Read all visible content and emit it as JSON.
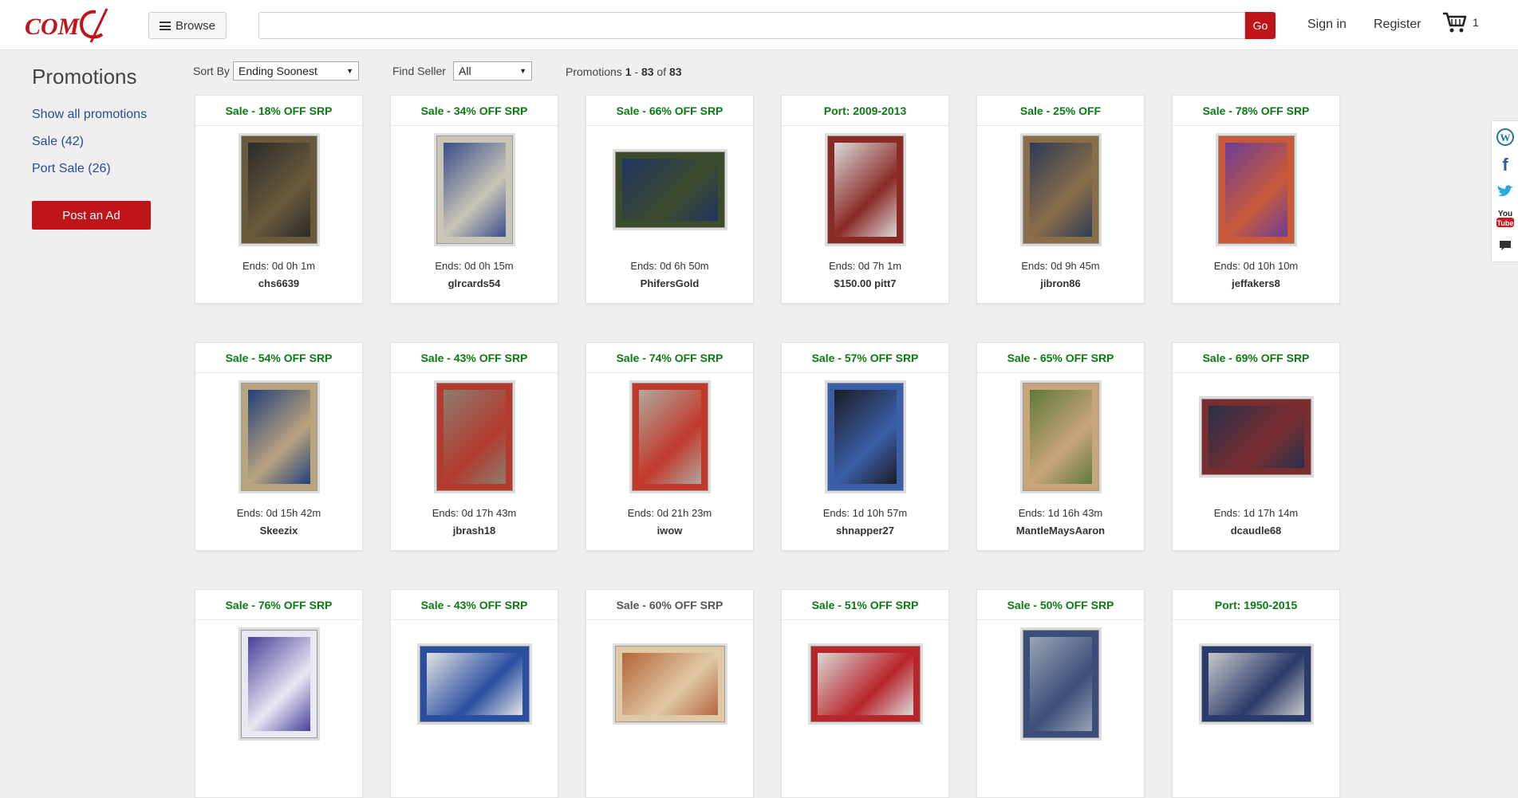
{
  "header": {
    "browse_label": "Browse",
    "search_placeholder": "",
    "go_label": "Go",
    "signin_label": "Sign in",
    "register_label": "Register",
    "cart_count": "1",
    "brand_color": "#c0141b"
  },
  "sidebar": {
    "title": "Promotions",
    "links": [
      {
        "label": "Show all promotions"
      },
      {
        "label": "Sale (42)"
      },
      {
        "label": "Port Sale (26)"
      }
    ],
    "post_ad_label": "Post an Ad"
  },
  "filters": {
    "sort_label": "Sort By",
    "sort_value": "Ending Soonest",
    "seller_label": "Find Seller",
    "seller_value": "All",
    "count_prefix": "Promotions",
    "count_start": "1",
    "count_end": "83",
    "count_of": "of",
    "count_total": "83"
  },
  "cards": [
    {
      "title": "Sale - 18% OFF SRP",
      "ends": "Ends: 0d 0h 1m",
      "seller": "chs6639",
      "img": "portrait",
      "c1": "#2b2b2b",
      "c2": "#6a5a3a"
    },
    {
      "title": "Sale - 34% OFF SRP",
      "ends": "Ends: 0d 0h 15m",
      "seller": "glrcards54",
      "img": "portrait",
      "c1": "#3b4d8a",
      "c2": "#c9c6b8"
    },
    {
      "title": "Sale - 66% OFF SRP",
      "ends": "Ends: 0d 6h 50m",
      "seller": "PhifersGold",
      "img": "landscape",
      "c1": "#1f3561",
      "c2": "#3c4b2c"
    },
    {
      "title": "Port: 2009-2013",
      "ends": "Ends: 0d 7h 1m",
      "seller": "$150.00 pitt7",
      "img": "portrait",
      "c1": "#d9d9d9",
      "c2": "#8a2a25"
    },
    {
      "title": "Sale - 25% OFF",
      "ends": "Ends: 0d 9h 45m",
      "seller": "jibron86",
      "img": "portrait",
      "c1": "#2d3b56",
      "c2": "#8a6e4a"
    },
    {
      "title": "Sale - 78% OFF SRP",
      "ends": "Ends: 0d 10h 10m",
      "seller": "jeffakers8",
      "img": "portrait",
      "c1": "#6c3d95",
      "c2": "#c85a3a"
    },
    {
      "title": "Sale - 54% OFF SRP",
      "ends": "Ends: 0d 15h 42m",
      "seller": "Skeezix",
      "img": "portrait",
      "c1": "#213f7a",
      "c2": "#b9a47e"
    },
    {
      "title": "Sale - 43% OFF SRP",
      "ends": "Ends: 0d 17h 43m",
      "seller": "jbrash18",
      "img": "portrait",
      "c1": "#8a7d6e",
      "c2": "#b23a2e"
    },
    {
      "title": "Sale - 74% OFF SRP",
      "ends": "Ends: 0d 21h 23m",
      "seller": "iwow",
      "img": "portrait",
      "c1": "#b0a9a0",
      "c2": "#c0392b"
    },
    {
      "title": "Sale - 57% OFF SRP",
      "ends": "Ends: 1d 10h 57m",
      "seller": "shnapper27",
      "img": "portrait",
      "c1": "#1c1c24",
      "c2": "#3b5fa8"
    },
    {
      "title": "Sale - 65% OFF SRP",
      "ends": "Ends: 1d 16h 43m",
      "seller": "MantleMaysAaron",
      "img": "portrait",
      "c1": "#5f7a3a",
      "c2": "#c9a57a"
    },
    {
      "title": "Sale - 69% OFF SRP",
      "ends": "Ends: 1d 17h 14m",
      "seller": "dcaudle68",
      "img": "landscape",
      "c1": "#26304a",
      "c2": "#7a2d30"
    },
    {
      "title": "Sale - 76% OFF SRP",
      "ends": "",
      "seller": "",
      "img": "portrait",
      "c1": "#4a3f9a",
      "c2": "#e8e8f2"
    },
    {
      "title": "Sale - 43% OFF SRP",
      "ends": "",
      "seller": "",
      "img": "landscape",
      "c1": "#e3e3e3",
      "c2": "#2a4fa0"
    },
    {
      "title": "Sale - 60% OFF SRP",
      "ends": "",
      "seller": "",
      "img": "landscape",
      "c1": "#b4653a",
      "c2": "#e0c9a6",
      "grey": true
    },
    {
      "title": "Sale - 51% OFF SRP",
      "ends": "",
      "seller": "",
      "img": "landscape",
      "c1": "#d8d8d8",
      "c2": "#b8252a"
    },
    {
      "title": "Sale - 50% OFF SRP",
      "ends": "",
      "seller": "",
      "img": "portrait",
      "c1": "#9aa4b4",
      "c2": "#3b4e7a"
    },
    {
      "title": "Port: 1950-2015",
      "ends": "",
      "seller": "",
      "img": "landscape",
      "c1": "#c9c9c9",
      "c2": "#2a3a6a"
    }
  ],
  "social": [
    "wordpress-icon",
    "facebook-icon",
    "twitter-icon",
    "youtube-icon",
    "comment-icon"
  ],
  "social_labels": {
    "youtube_text_top": "You",
    "youtube_text_bottom": "Tube"
  }
}
